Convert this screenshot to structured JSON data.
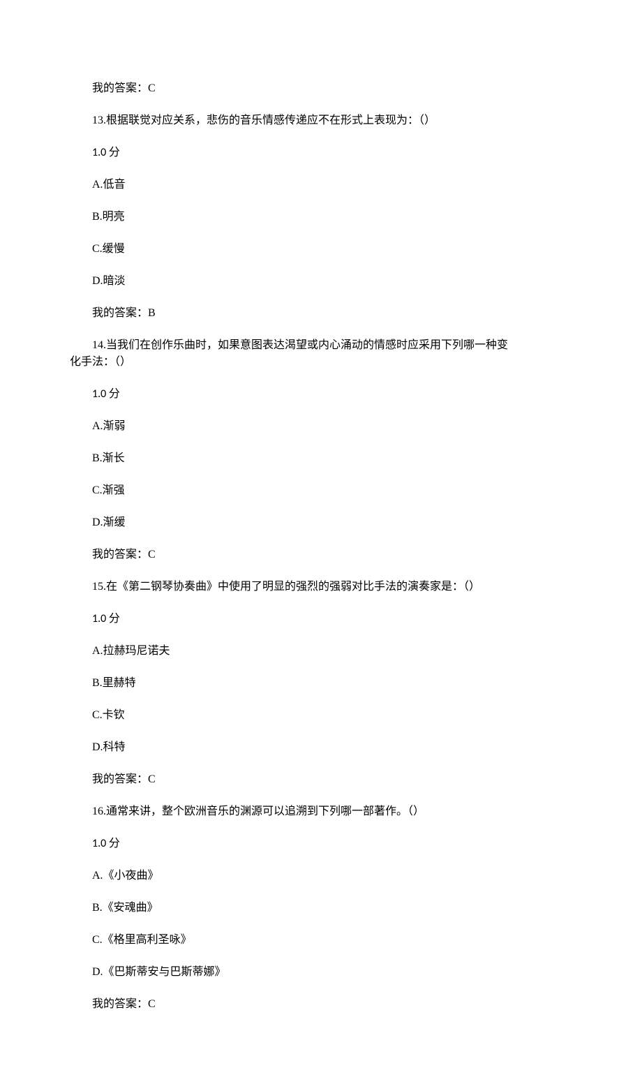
{
  "lines": {
    "ans12": "我的答案：C",
    "q13": "13.根据联觉对应关系，悲伤的音乐情感传递应不在形式上表现为：（）",
    "p13": "1.0 分",
    "o13a": "A.低音",
    "o13b": "B.明亮",
    "o13c": "C.缓慢",
    "o13d": "D.暗淡",
    "ans13": "我的答案：B",
    "q14_first": "14.当我们在创作乐曲时，如果意图表达渴望或内心涌动的情感时应采用下列哪一种变",
    "q14_cont": "化手法：（）",
    "p14": "1.0 分",
    "o14a": "A.渐弱",
    "o14b": "B.渐长",
    "o14c": "C.渐强",
    "o14d": "D.渐缓",
    "ans14": "我的答案：C",
    "q15": "15.在《第二钢琴协奏曲》中使用了明显的强烈的强弱对比手法的演奏家是：（）",
    "p15": "1.0 分",
    "o15a": "A.拉赫玛尼诺夫",
    "o15b": "B.里赫特",
    "o15c": "C.卡钦",
    "o15d": "D.科特",
    "ans15": "我的答案：C",
    "q16": "16.通常来讲，整个欧洲音乐的渊源可以追溯到下列哪一部著作。（）",
    "p16": "1.0 分",
    "o16a": "A.《小夜曲》",
    "o16b": "B.《安魂曲》",
    "o16c": "C.《格里高利圣咏》",
    "o16d": "D.《巴斯蒂安与巴斯蒂娜》",
    "ans16": "我的答案：C"
  }
}
